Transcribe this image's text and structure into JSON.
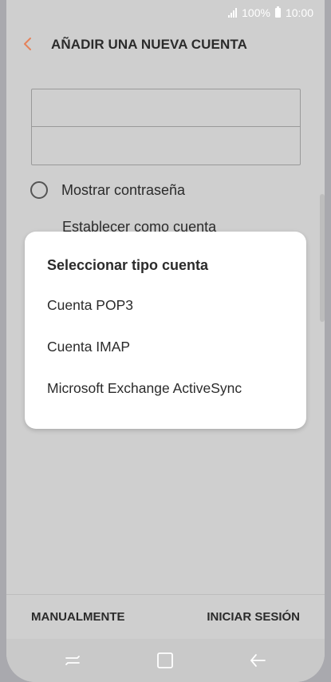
{
  "status_bar": {
    "battery_percent": "100%",
    "time": "10:00"
  },
  "header": {
    "title": "AÑADIR UNA NUEVA CUENTA"
  },
  "form": {
    "email_placeholder": "",
    "password_placeholder": "",
    "show_password_label": "Mostrar contraseña",
    "set_default_label": "Establecer como cuenta"
  },
  "dialog": {
    "title": "Seleccionar tipo cuenta",
    "options": [
      "Cuenta POP3",
      "Cuenta IMAP",
      "Microsoft Exchange ActiveSync"
    ]
  },
  "bottom_bar": {
    "manual_label": "MANUALMENTE",
    "login_label": "INICIAR SESIÓN"
  },
  "colors": {
    "accent": "#e5825a",
    "dialog_bg": "#ffffff",
    "dimmed_bg": "#cfcfcf"
  },
  "icons": [
    "signal-icon",
    "battery-icon",
    "back-arrow-icon",
    "radio-icon",
    "recents-icon",
    "home-icon",
    "nav-back-icon"
  ]
}
